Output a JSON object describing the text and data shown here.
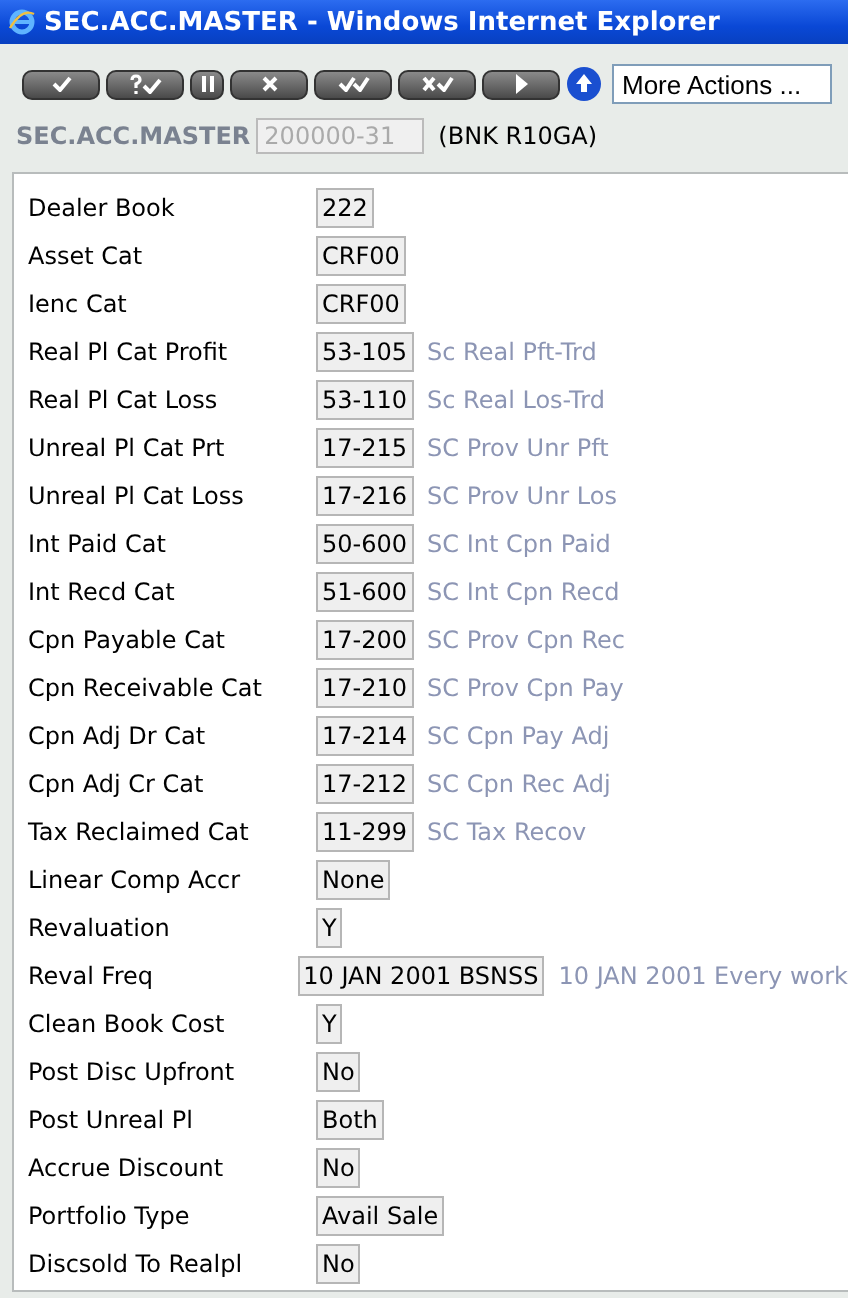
{
  "window": {
    "title": "SEC.ACC.MASTER - Windows Internet Explorer"
  },
  "toolbar": {
    "buttons": [
      {
        "kind": "check"
      },
      {
        "kind": "query-check"
      },
      {
        "kind": "pause"
      },
      {
        "kind": "cross"
      },
      {
        "kind": "double-check"
      },
      {
        "kind": "cross-check"
      },
      {
        "kind": "play"
      }
    ],
    "more_actions": {
      "value": "More Actions ..."
    }
  },
  "record": {
    "application": "SEC.ACC.MASTER",
    "id": {
      "value": "200000-31",
      "disabled": true
    },
    "company": "(BNK R10GA)"
  },
  "fields": [
    {
      "label": "Dealer Book",
      "value": "222"
    },
    {
      "label": "Asset Cat",
      "value": "CRF00"
    },
    {
      "label": "Ienc Cat",
      "value": "CRF00"
    },
    {
      "label": "Real Pl Cat Profit",
      "value": "53-105",
      "description": "Sc Real Pft-Trd"
    },
    {
      "label": "Real Pl Cat Loss",
      "value": "53-110",
      "description": "Sc Real Los-Trd"
    },
    {
      "label": "Unreal Pl Cat Prt",
      "value": "17-215",
      "description": "SC Prov Unr Pft"
    },
    {
      "label": "Unreal Pl Cat Loss",
      "value": "17-216",
      "description": "SC Prov Unr Los"
    },
    {
      "label": "Int Paid Cat",
      "value": "50-600",
      "description": "SC Int Cpn Paid"
    },
    {
      "label": "Int Recd Cat",
      "value": "51-600",
      "description": "SC Int Cpn Recd"
    },
    {
      "label": "Cpn Payable Cat",
      "value": "17-200",
      "description": "SC Prov Cpn Rec"
    },
    {
      "label": "Cpn Receivable Cat",
      "value": "17-210",
      "description": "SC Prov Cpn Pay"
    },
    {
      "label": "Cpn Adj Dr Cat",
      "value": "17-214",
      "description": "SC Cpn Pay Adj"
    },
    {
      "label": "Cpn Adj Cr Cat",
      "value": "17-212",
      "description": "SC Cpn Rec Adj"
    },
    {
      "label": "Tax Reclaimed Cat",
      "value": "11-299",
      "description": "SC Tax Recov"
    },
    {
      "label": "Linear Comp Accr",
      "value": "None"
    },
    {
      "label": "Revaluation",
      "value": "Y"
    },
    {
      "label": "Reval Freq",
      "value": "10 JAN 2001 BSNSS",
      "description": "10 JAN 2001 Every work"
    },
    {
      "label": "Clean Book Cost",
      "value": "Y"
    },
    {
      "label": "Post Disc Upfront",
      "value": "No"
    },
    {
      "label": "Post Unreal Pl",
      "value": "Both"
    },
    {
      "label": "Accrue Discount",
      "value": "No"
    },
    {
      "label": "Portfolio Type",
      "value": "Avail Sale"
    },
    {
      "label": "Discsold To Realpl",
      "value": "No"
    }
  ]
}
